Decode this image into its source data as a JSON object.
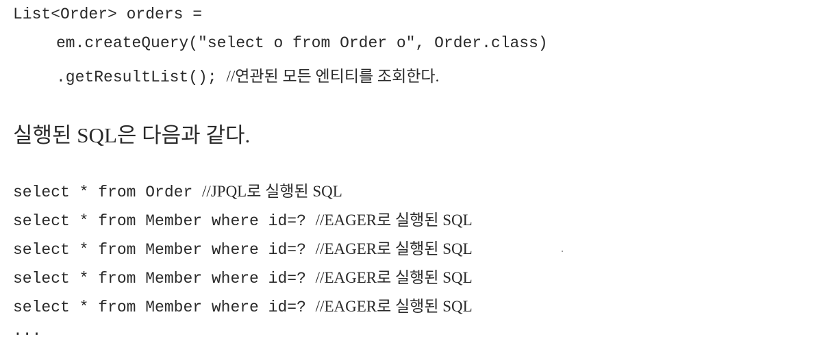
{
  "code_block_1": {
    "line1": "List<Order> orders =",
    "line2": "em.createQuery(\"select o from Order o\", Order.class)",
    "line3_code": ".getResultList(); ",
    "line3_comment": "//연관된 모든 엔티티를 조회한다."
  },
  "prose": {
    "text": "실행된 SQL은 다음과 같다."
  },
  "code_block_2": {
    "lines": [
      {
        "code": "select * from Order ",
        "comment": "//JPQL로 실행된 SQL"
      },
      {
        "code": "select * from Member where id=? ",
        "comment": "//EAGER로 실행된 SQL"
      },
      {
        "code": "select * from Member where id=? ",
        "comment": "//EAGER로 실행된 SQL"
      },
      {
        "code": "select * from Member where id=? ",
        "comment": "//EAGER로 실행된 SQL"
      },
      {
        "code": "select * from Member where id=? ",
        "comment": "//EAGER로 실행된 SQL"
      }
    ],
    "ellipsis": "..."
  }
}
